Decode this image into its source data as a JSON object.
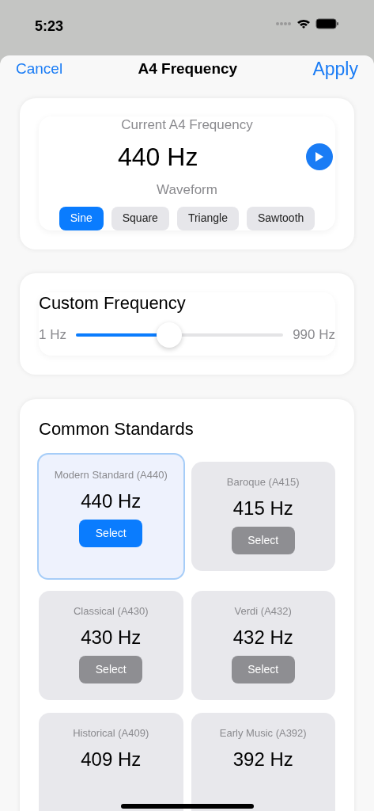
{
  "status_bar": {
    "time": "5:23"
  },
  "nav": {
    "cancel": "Cancel",
    "title": "A4 Frequency",
    "apply": "Apply"
  },
  "current": {
    "label": "Current A4 Frequency",
    "value": "440 Hz",
    "waveform_label": "Waveform",
    "waveforms": [
      {
        "label": "Sine",
        "selected": true
      },
      {
        "label": "Square",
        "selected": false
      },
      {
        "label": "Triangle",
        "selected": false
      },
      {
        "label": "Sawtooth",
        "selected": false
      }
    ]
  },
  "custom": {
    "title": "Custom Frequency",
    "min": "1 Hz",
    "max": "990 Hz",
    "level": 0.45
  },
  "standards": {
    "title": "Common Standards",
    "items": [
      {
        "name": "Modern Standard (A440)",
        "value": "440 Hz",
        "button": "Select",
        "selected": true
      },
      {
        "name": "Baroque (A415)",
        "value": "415 Hz",
        "button": "Select",
        "selected": false
      },
      {
        "name": "Classical (A430)",
        "value": "430 Hz",
        "button": "Select",
        "selected": false
      },
      {
        "name": "Verdi (A432)",
        "value": "432 Hz",
        "button": "Select",
        "selected": false
      },
      {
        "name": "Historical (A409)",
        "value": "409 Hz",
        "selected": false
      },
      {
        "name": "Early Music (A392)",
        "value": "392 Hz",
        "selected": false
      }
    ]
  }
}
